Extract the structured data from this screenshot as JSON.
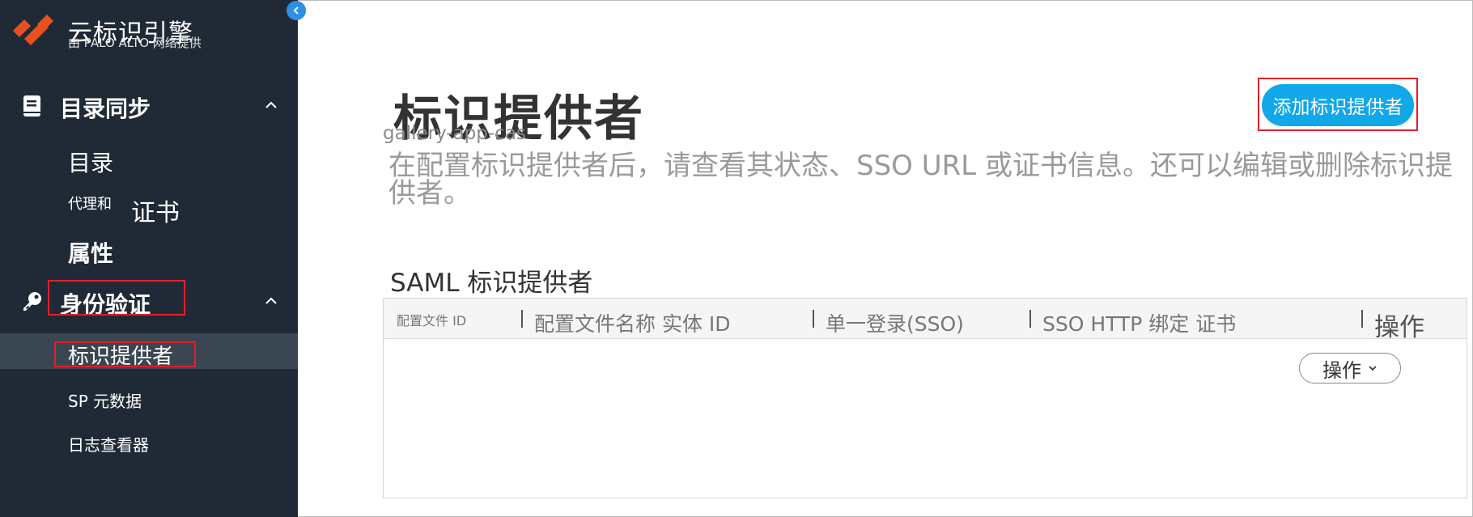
{
  "app": {
    "title": "云标识引擎",
    "subtitle": "由 PALO ALTO 网络提供"
  },
  "sidebar": {
    "sections": [
      {
        "label": "目录同步",
        "icon": "book-icon",
        "expanded": true,
        "items": [
          {
            "label": "目录"
          },
          {
            "label": "代理和",
            "label2": "证书"
          },
          {
            "label": "属性"
          }
        ]
      },
      {
        "label": "身份验证",
        "icon": "key-icon",
        "expanded": true,
        "items": [
          {
            "label": "标识提供者",
            "active": true
          },
          {
            "label": "SP 元数据"
          },
          {
            "label": "日志查看器"
          }
        ]
      }
    ]
  },
  "main": {
    "title": "标识提供者",
    "app_tag": "gallery-app-cas",
    "description": "在配置标识提供者后，请查看其状态、SSO URL 或证书信息。还可以编辑或删除标识提供者。",
    "add_button": "添加标识提供者",
    "saml_section_title": "SAML 标识提供者",
    "table": {
      "columns": [
        "配置文件 ID",
        "配置文件名称 实体 ID",
        "单一登录(SSO)",
        "SSO HTTP 绑定 证书",
        "操作"
      ],
      "rows": [],
      "row_action": "操作"
    }
  },
  "colors": {
    "sidebar_bg": "#1f2a36",
    "sidebar_active": "#3a4652",
    "primary_button": "#11a8ea",
    "highlight_box": "#e0202a",
    "logo": "#e8501e"
  }
}
